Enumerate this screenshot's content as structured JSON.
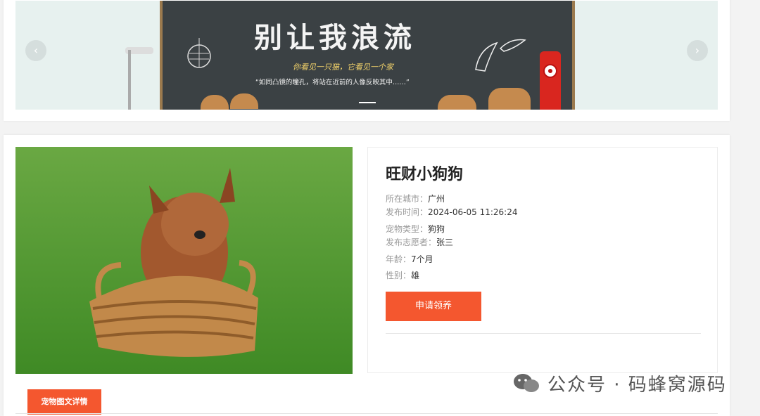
{
  "banner": {
    "title": "别让我浪流",
    "subtitle": "你看见一只猫，它看见一个家",
    "quote": "“如同凸镜的瞳孔，将站在近前的人像反映其中……”",
    "prev_icon": "chevron-left-icon",
    "next_icon": "chevron-right-icon"
  },
  "pet": {
    "name": "旺财小狗狗",
    "city_label": "所在城市：",
    "city": "广州",
    "time_label": "发布时间：",
    "time": "2024-06-05 11:26:24",
    "type_label": "宠物类型：",
    "type": "狗狗",
    "volunteer_label": "发布志愿者：",
    "volunteer": "张三",
    "age_label": "年龄：",
    "age": "7个月",
    "gender_label": "性别：",
    "gender": "雄",
    "adopt_button": "申请领养"
  },
  "tabs": {
    "detail": "宠物图文详情"
  },
  "watermark": {
    "text": "公众号 · 码蜂窝源码"
  },
  "colors": {
    "accent": "#f4572f",
    "banner_bg": "#e7f1ef"
  }
}
